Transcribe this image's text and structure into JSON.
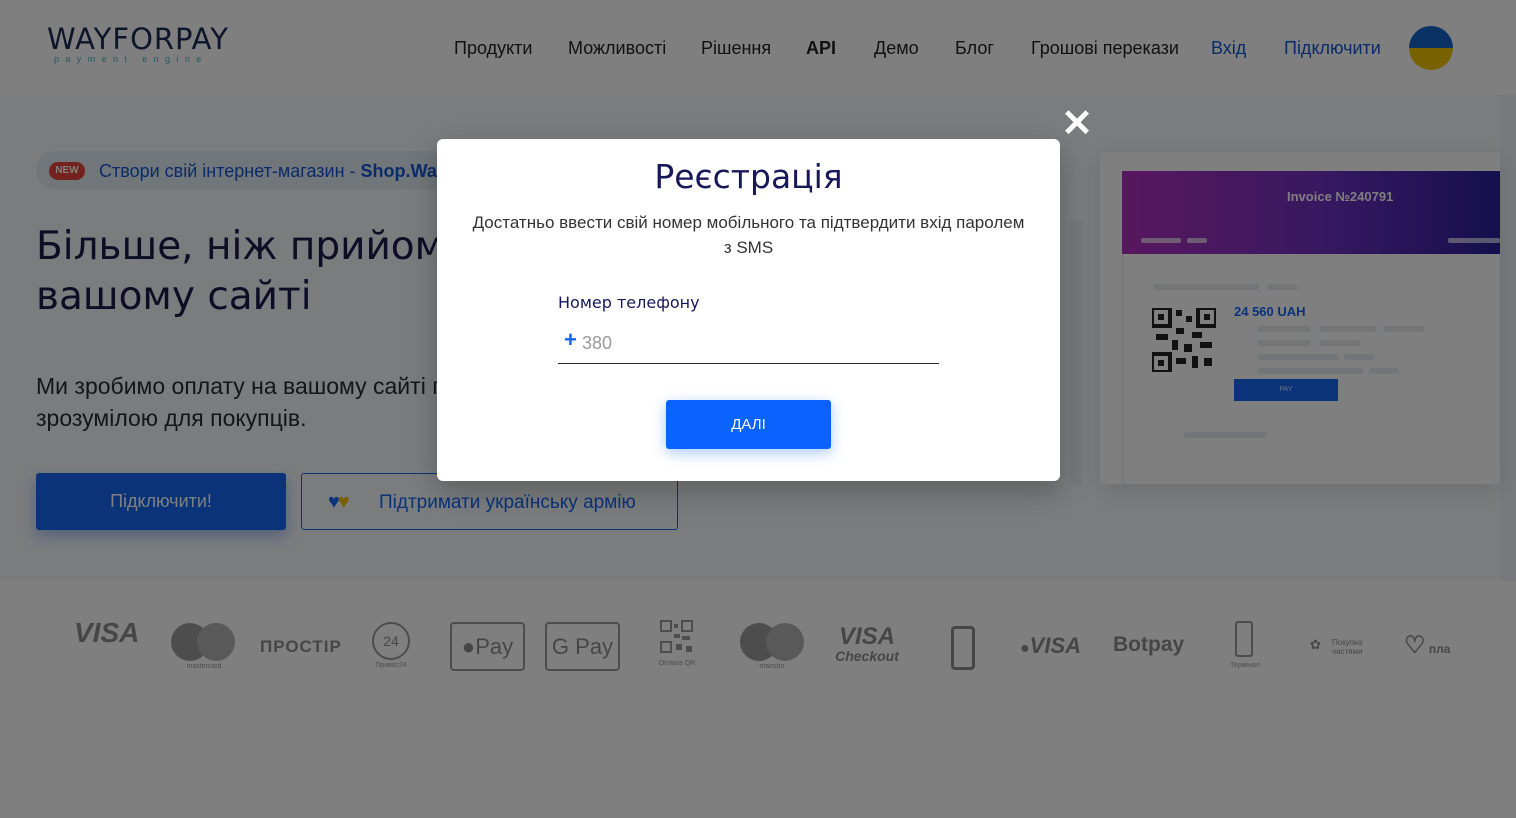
{
  "header": {
    "logo_text": "WAYFORPAY",
    "logo_sub": "payment engine",
    "nav": [
      "Продукти",
      "Можливості",
      "Рішення",
      "API",
      "Демо",
      "Блог",
      "Грошові перекази"
    ],
    "login_label": "Вхід",
    "connect_label": "Підключити",
    "flag_icon": "ukraine-flag-icon"
  },
  "hero": {
    "promo_badge": "NEW",
    "promo_text": "Створи свій інтернет-магазин -",
    "promo_link": "Shop.Way",
    "title_line1": "Більше, ніж прийом",
    "title_line2": "вашому сайті",
    "desc_line1": "Ми зробимо оплату на вашому сайті п",
    "desc_line2": "зрозумілою для покупців.",
    "connect_button": "Підключити!",
    "support_button": "Підтримати українську армію"
  },
  "invoice": {
    "title": "Invoice №240791",
    "amount": "24 560 UAH",
    "pay_button": "PAY"
  },
  "payments": {
    "visa": "VISA",
    "mastercard": "mastercard",
    "prostir": "ПРОСТІР",
    "privat_num": "24",
    "privat": "Приват24",
    "apple_pay": "Pay",
    "google_pay": "G Pay",
    "qr": "Оплата QR",
    "maestro": "maestro",
    "visa_checkout_1": "VISA",
    "visa_checkout_2": "Checkout",
    "mvisa": "VISA",
    "botpay": "Botpay",
    "terminal": "Термінал",
    "installments": "Покупка частями",
    "plata": "пла"
  },
  "modal": {
    "title": "Реєстрація",
    "subtitle_line1": "Достатньо ввести свій номер мобільного та підтвердити вхід паролем",
    "subtitle_line2": "з SMS",
    "phone_label": "Номер телефону",
    "phone_prefix": "+",
    "phone_placeholder": "380",
    "next_button": "ДАЛІ",
    "close_icon": "close-icon"
  },
  "colors": {
    "accent": "#1466f2",
    "button": "#0a63ff",
    "title": "#17185a",
    "overlay": "rgba(0,0,0,0.5)"
  }
}
